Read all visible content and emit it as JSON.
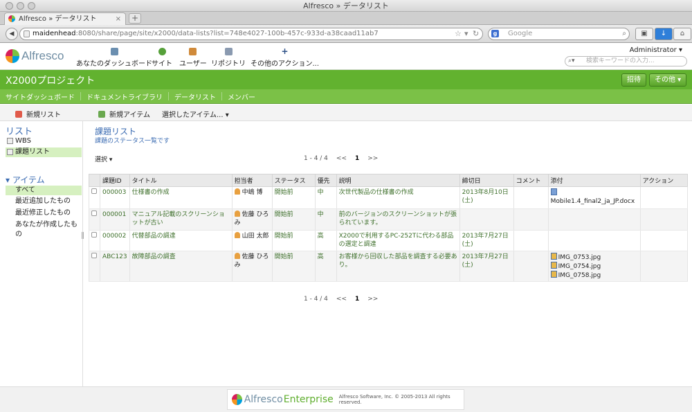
{
  "window": {
    "title": "Alfresco » データリスト"
  },
  "browser": {
    "tab_label": "Alfresco » データリスト",
    "tab_close": "×",
    "new_tab": "+",
    "url_host": "maidenhead",
    "url_rest": ":8080/share/page/site/x2000/data-lists?list=748e4027-100b-457c-933d-a38caad11ab7",
    "search_placeholder": "Google"
  },
  "header": {
    "logo_text": "Alfresco",
    "nav": [
      {
        "label": "あなたのダッシュボード",
        "color": "#6b8fb0"
      },
      {
        "label": "サイト",
        "color": "#56a03a"
      },
      {
        "label": "ユーザー",
        "color": "#d08a3a"
      },
      {
        "label": "リポジトリ",
        "color": "#8a9ab0"
      },
      {
        "label": "その他のアクション...",
        "color": "#2b4f86"
      }
    ],
    "user": "Administrator ▾",
    "search_placeholder": "検索キーワードの入力..."
  },
  "site": {
    "title": "X2000プロジェクト",
    "invite": "招待",
    "more": "その他 ▾",
    "nav": [
      "サイトダッシュボード",
      "ドキュメントライブラリ",
      "データリスト",
      "メンバー"
    ]
  },
  "toolbar": {
    "new_list": "新規リスト",
    "new_item": "新規アイテム",
    "selected_items": "選択したアイテム... ▾"
  },
  "left": {
    "lists_heading": "リスト",
    "lists": [
      "WBS",
      "課題リスト"
    ],
    "items_heading": "▾ アイテム",
    "filters": [
      "すべて",
      "最近追加したもの",
      "最近修正したもの",
      "あなたが作成したもの"
    ]
  },
  "main": {
    "title": "課題リスト",
    "description": "課題のステータス一覧です",
    "select": "選択 ▾",
    "pager": {
      "range": "1 - 4 / 4",
      "prev": "<<",
      "current": "1",
      "next": ">>"
    },
    "columns": [
      "",
      "課題ID",
      "タイトル",
      "担当者",
      "ステータス",
      "優先",
      "説明",
      "締切日",
      "コメント",
      "添付",
      "アクション"
    ],
    "rows": [
      {
        "id": "000003",
        "title": "仕様書の作成",
        "assignee": "中嶋 博",
        "status": "開始前",
        "priority": "中",
        "desc": "次世代製品の仕様書の作成",
        "due": "2013年8月10日(土)",
        "comment": "",
        "attachments": [
          "Mobile1.4_final2_ja_JP.docx"
        ]
      },
      {
        "id": "000001",
        "title": "マニュアル記載のスクリーンショットが古い",
        "assignee": "佐藤 ひろみ",
        "status": "開始前",
        "priority": "中",
        "desc": "前のバージョンのスクリーンショットが張られています。",
        "due": "",
        "comment": "",
        "attachments": []
      },
      {
        "id": "000002",
        "title": "代替部品の調達",
        "assignee": "山田 太郎",
        "status": "開始前",
        "priority": "高",
        "desc": "X2000で利用するPC-252Tに代わる部品の選定と調達",
        "due": "2013年7月27日(土)",
        "comment": "",
        "attachments": []
      },
      {
        "id": "ABC123",
        "title": "故障部品の調査",
        "assignee": "佐藤 ひろみ",
        "status": "開始前",
        "priority": "高",
        "desc": "お客様から回収した部品を調査する必要あり。",
        "due": "2013年7月27日(土)",
        "comment": "",
        "attachments": [
          "IMG_0753.jpg",
          "IMG_0754.jpg",
          "IMG_0758.jpg"
        ]
      }
    ]
  },
  "footer": {
    "brand_a": "Alfresco",
    "brand_e": "Enterprise",
    "copyright": "Alfresco Software, Inc. © 2005-2013 All rights reserved."
  }
}
